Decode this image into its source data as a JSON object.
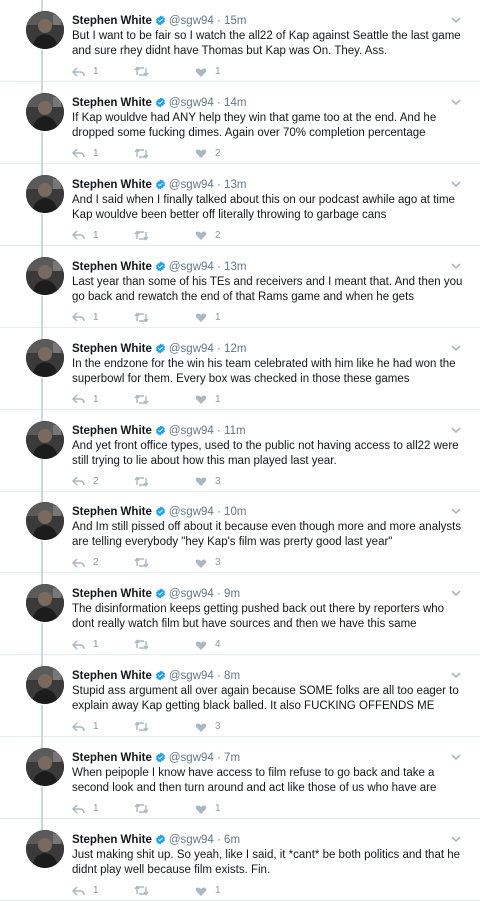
{
  "colors": {
    "thread_line": "#ccd6dd",
    "verified": "#1da1f2",
    "muted": "#657786",
    "action": "#8899a6"
  },
  "icons": [
    "reply-icon",
    "retweet-icon",
    "like-icon",
    "verified-icon",
    "caret-down-icon"
  ],
  "tweets": [
    {
      "name": "Stephen White",
      "handle": "@sgw94",
      "dot": "·",
      "time": "15m",
      "text": "But I want to be fair so I watch the all22 of Kap against Seattle the last game and sure rhey didnt have Thomas but Kap was On. They. Ass.",
      "replies": "1",
      "retweets": "",
      "likes": "1"
    },
    {
      "name": "Stephen White",
      "handle": "@sgw94",
      "dot": "·",
      "time": "14m",
      "text": "If Kap wouldve had ANY help they win that game too at the end. And he dropped some fucking dimes. Again over 70% completion percentage",
      "replies": "1",
      "retweets": "",
      "likes": "2"
    },
    {
      "name": "Stephen White",
      "handle": "@sgw94",
      "dot": "·",
      "time": "13m",
      "text": "And I said when I finally talked about this on our podcast awhile ago at time Kap wouldve been better off literally throwing to garbage cans",
      "replies": "1",
      "retweets": "",
      "likes": "2"
    },
    {
      "name": "Stephen White",
      "handle": "@sgw94",
      "dot": "·",
      "time": "13m",
      "text": "Last year than some of his TEs and receivers and I meant that. And then you go back and rewatch the end of that Rams game and when he gets",
      "replies": "1",
      "retweets": "",
      "likes": "1"
    },
    {
      "name": "Stephen White",
      "handle": "@sgw94",
      "dot": "·",
      "time": "12m",
      "text": "In the endzone for the win his team celebrated with him like he had won the superbowl for them. Every box was checked in those these games",
      "replies": "1",
      "retweets": "",
      "likes": "1"
    },
    {
      "name": "Stephen White",
      "handle": "@sgw94",
      "dot": "·",
      "time": "11m",
      "text": "And yet front office types, used to the public not having access to all22 were still trying to lie about how this man played last year.",
      "replies": "2",
      "retweets": "",
      "likes": "3"
    },
    {
      "name": "Stephen White",
      "handle": "@sgw94",
      "dot": "·",
      "time": "10m",
      "text": "And Im still pissed off about it because even though more and more analysts are telling everybody \"hey Kap's film was prerty good last year\"",
      "replies": "2",
      "retweets": "",
      "likes": "3"
    },
    {
      "name": "Stephen White",
      "handle": "@sgw94",
      "dot": "·",
      "time": "9m",
      "text": "The disinformation keeps getting pushed back out there by reporters who dont really watch film but have sources and then we have this same",
      "replies": "1",
      "retweets": "",
      "likes": "4"
    },
    {
      "name": "Stephen White",
      "handle": "@sgw94",
      "dot": "·",
      "time": "8m",
      "text": "Stupid ass argument all over again because SOME folks are all too eager to explain away Kap getting black balled. It also FUCKING OFFENDS ME",
      "replies": "1",
      "retweets": "",
      "likes": "3"
    },
    {
      "name": "Stephen White",
      "handle": "@sgw94",
      "dot": "·",
      "time": "7m",
      "text": "When peipople I know have access to film refuse to go back and take a second look and then turn around and act like those of us who have are",
      "replies": "1",
      "retweets": "",
      "likes": "1"
    },
    {
      "name": "Stephen White",
      "handle": "@sgw94",
      "dot": "·",
      "time": "6m",
      "text": "Just making shit up. So yeah, like I said, it *cant* be both politics and that he didnt play well because film exists. Fin.",
      "replies": "1",
      "retweets": "",
      "likes": "1"
    }
  ]
}
